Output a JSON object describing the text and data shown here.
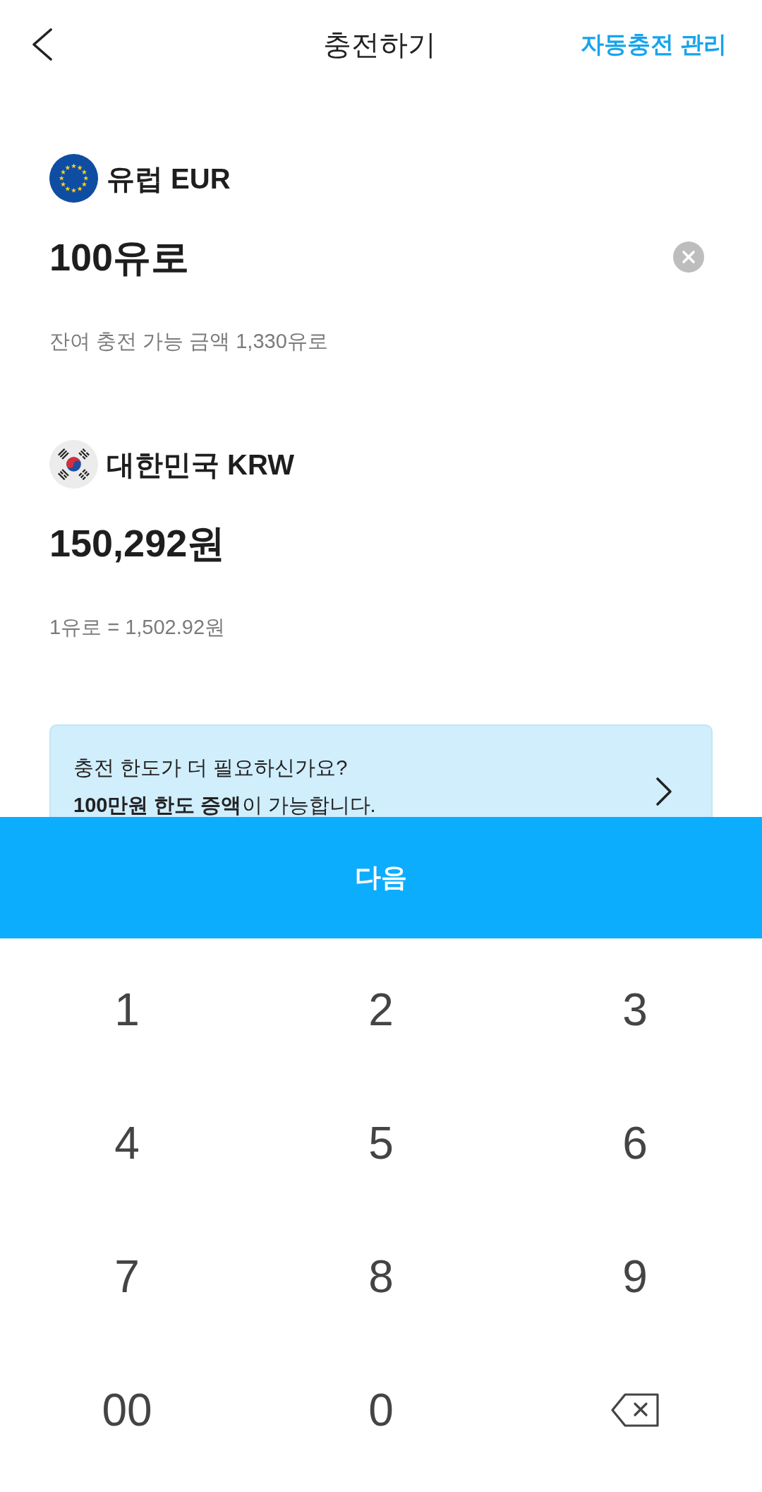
{
  "header": {
    "title": "충전하기",
    "action": "자동충전 관리"
  },
  "currencies": [
    {
      "kind": "eu",
      "name": "유럽 EUR",
      "amount": "100유로",
      "clearable": true,
      "note": "잔여 충전 가능 금액 1,330유로"
    },
    {
      "kind": "kr",
      "name": "대한민국 KRW",
      "amount": "150,292원",
      "clearable": false,
      "note": "1유로 = 1,502.92원"
    }
  ],
  "banner": {
    "lines": [
      "충전 한도가 더 필요하신가요?",
      "**100만원 한도 증액**이 가능합니다."
    ]
  },
  "next_button": {
    "label": "다음"
  },
  "keypad": {
    "keys": [
      {
        "kind": "digit",
        "label": "1"
      },
      {
        "kind": "digit",
        "label": "2"
      },
      {
        "kind": "digit",
        "label": "3"
      },
      {
        "kind": "digit",
        "label": "4"
      },
      {
        "kind": "digit",
        "label": "5"
      },
      {
        "kind": "digit",
        "label": "6"
      },
      {
        "kind": "digit",
        "label": "7"
      },
      {
        "kind": "digit",
        "label": "8"
      },
      {
        "kind": "digit",
        "label": "9"
      },
      {
        "kind": "digit",
        "label": "00"
      },
      {
        "kind": "digit",
        "label": "0"
      },
      {
        "kind": "backspace"
      }
    ]
  }
}
